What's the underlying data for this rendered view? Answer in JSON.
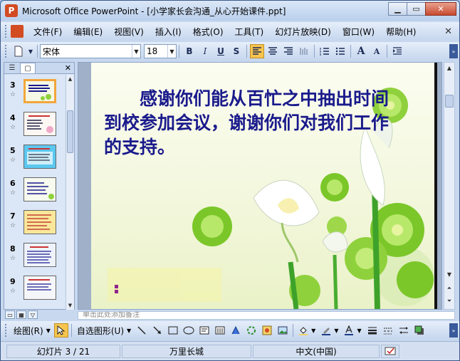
{
  "window": {
    "title": "Microsoft Office PowerPoint - [小学家长会沟通_从心开始课件.ppt]",
    "app_icon": "P"
  },
  "window_controls": {
    "minimize": "▁",
    "restore": "▭",
    "close": "✕"
  },
  "menubar": {
    "items": [
      "文件(F)",
      "编辑(E)",
      "视图(V)",
      "插入(I)",
      "格式(O)",
      "工具(T)",
      "幻灯片放映(D)",
      "窗口(W)",
      "帮助(H)"
    ],
    "close_glyph": "✕"
  },
  "format_toolbar": {
    "font_name": "宋体",
    "font_size": "18",
    "bold": "B",
    "italic": "I",
    "underline": "U",
    "shadow": "S",
    "increase_font": "A",
    "decrease_font": "A"
  },
  "left_panel": {
    "tab_outline": "☰",
    "tab_slides": "▢",
    "close_glyph": "✕",
    "thumbnails": [
      {
        "num": "3",
        "selected": true
      },
      {
        "num": "4",
        "selected": false
      },
      {
        "num": "5",
        "selected": false
      },
      {
        "num": "6",
        "selected": false
      },
      {
        "num": "7",
        "selected": false
      },
      {
        "num": "8",
        "selected": false
      },
      {
        "num": "9",
        "selected": false
      }
    ],
    "star_glyph": "☆"
  },
  "slide": {
    "text": "感谢你们能从百忙之中抽出时间到校参加会议，谢谢你们对我们工作的支持。",
    "text_color": "#1a1a8c"
  },
  "notes": {
    "placeholder": "单击此处添加备注"
  },
  "drawing_toolbar": {
    "draw_label": "绘图(R)",
    "autoshape_label": "自选图形(U)"
  },
  "statusbar": {
    "slide_info": "幻灯片 3 / 21",
    "design": "万里长城",
    "language": "中文(中国)"
  }
}
